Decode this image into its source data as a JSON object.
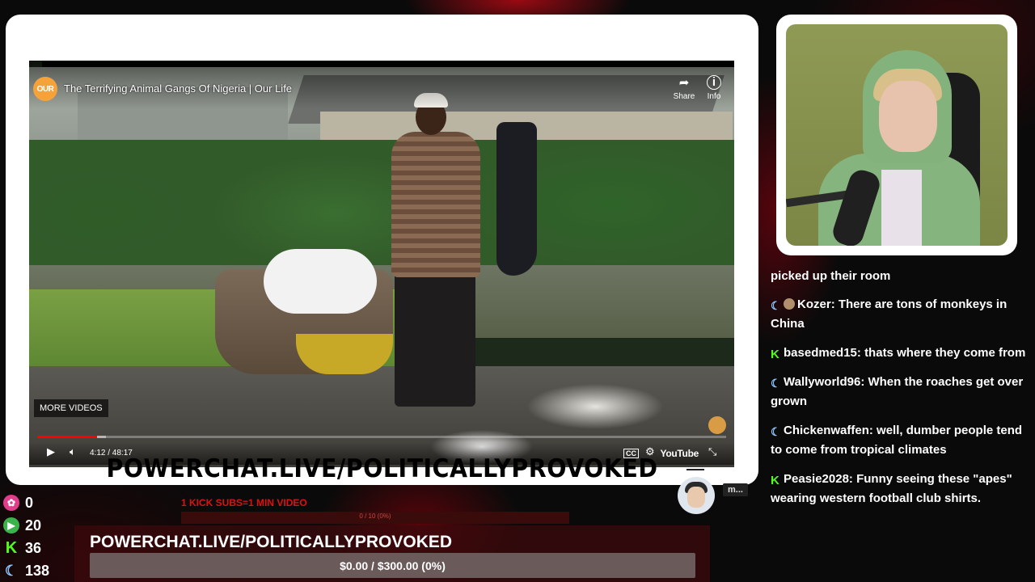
{
  "video": {
    "channel_logo": "OUR",
    "title": "The Terrifying Animal Gangs Of Nigeria | Our Life",
    "share_label": "Share",
    "info_label": "Info",
    "more_videos_label": "MORE VIDEOS",
    "time": "4:12 / 48:17",
    "progress_fraction": 0.087,
    "loaded_fraction": 0.1,
    "brand": "YouTube",
    "icons": {
      "share": "share-arrow-icon",
      "info": "info-icon",
      "play": "play-icon",
      "volume": "volume-icon",
      "cc": "cc-icon",
      "settings": "settings-gear-icon",
      "fullscreen": "exit-fullscreen-icon"
    }
  },
  "banner": {
    "url_text": "POWERCHAT.LIVE/POLITICALLYPROVOKED"
  },
  "chat": {
    "messages": [
      {
        "badges": [],
        "user": "",
        "text": "picked up their room"
      },
      {
        "badges": [
          "moon",
          "avatar"
        ],
        "user": "Kozer",
        "text": "There are tons of monkeys in China"
      },
      {
        "badges": [
          "kick"
        ],
        "user": "basedmed15",
        "text": "thats where they come from"
      },
      {
        "badges": [
          "moon"
        ],
        "user": "Wallyworld96",
        "text": "When the roaches get over grown"
      },
      {
        "badges": [
          "moon"
        ],
        "user": "Chickenwaffen",
        "text": "well, dumber people tend to come from tropical climates"
      },
      {
        "badges": [
          "kick"
        ],
        "user": "Peasie2028",
        "text": "Funny seeing these \"apes\" wearing western football club shirts."
      }
    ]
  },
  "stats": [
    {
      "icon": "heart-icon",
      "value": "0"
    },
    {
      "icon": "play-icon",
      "value": "20"
    },
    {
      "icon": "kick-icon",
      "value": "36"
    },
    {
      "icon": "moon-icon",
      "value": "138"
    }
  ],
  "overlay": {
    "kick_subs": "1 KICK SUBS=1 MIN VIDEO",
    "small_bar_text": "0 / 10 (0%)",
    "goal_title": "POWERCHAT.LIVE/POLITICALLYPROVOKED",
    "goal_text": "$0.00 / $300.00 (0%)",
    "goal_fraction": 0,
    "avatar_tag": "m..."
  },
  "colors": {
    "kick_green": "#53fc18",
    "accent_red": "#c02020",
    "moon_blue": "#8ec7ff"
  }
}
